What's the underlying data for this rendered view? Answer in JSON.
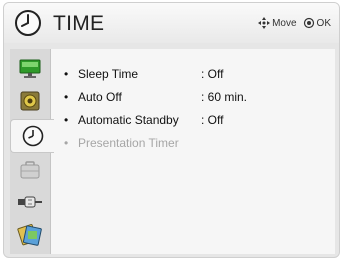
{
  "header": {
    "title": "TIME",
    "move_label": "Move",
    "ok_label": "OK"
  },
  "sidebar": {
    "items": [
      {
        "name": "picture",
        "icon": "monitor-icon"
      },
      {
        "name": "audio",
        "icon": "speaker-icon"
      },
      {
        "name": "time",
        "icon": "clock-icon",
        "active": true
      },
      {
        "name": "lock",
        "icon": "briefcase-icon"
      },
      {
        "name": "input",
        "icon": "plug-icon"
      },
      {
        "name": "option",
        "icon": "cards-icon"
      }
    ]
  },
  "menu": {
    "bullet": "•",
    "items": [
      {
        "label": "Sleep Time",
        "value": ": Off",
        "enabled": true
      },
      {
        "label": "Auto Off",
        "value": ": 60 min.",
        "enabled": true
      },
      {
        "label": "Automatic Standby",
        "value": ": Off",
        "enabled": true
      },
      {
        "label": "Presentation Timer",
        "value": "",
        "enabled": false
      }
    ]
  },
  "colors": {
    "background": "#f6f6f6",
    "sidebar": "#d9d9d9",
    "text": "#111111",
    "disabled_text": "#a6a6a6"
  }
}
